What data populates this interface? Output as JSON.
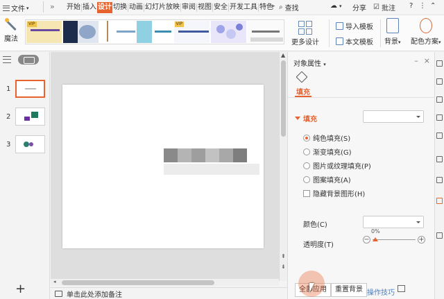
{
  "menubar": {
    "file": "文件",
    "more_arrow": "»",
    "tabs": [
      "开始",
      "插入",
      "设计",
      "切换",
      "动画",
      "幻灯片放映",
      "审阅",
      "视图",
      "安全",
      "开发工具",
      "特色"
    ],
    "active_tab": "设计",
    "search": "查找",
    "share": "分享",
    "comment": "批注",
    "help": "?"
  },
  "ribbon": {
    "magic": "魔法",
    "vip_badge": "VIP",
    "more_designs": "更多设计",
    "import_template": "导入模板",
    "text_template": "本文模板",
    "background": "背景",
    "color_scheme": "配色方案"
  },
  "left_panel": {
    "slides": [
      "1",
      "2",
      "3"
    ],
    "add": "+"
  },
  "status": {
    "notes_placeholder": "单击此处添加备注"
  },
  "right_panel": {
    "title": "对象属性",
    "tab_fill": "填充",
    "section_fill": "填充",
    "options": [
      {
        "label": "纯色填充(S)",
        "checked": true
      },
      {
        "label": "渐变填充(G)",
        "checked": false
      },
      {
        "label": "图片或纹理填充(P)",
        "checked": false
      },
      {
        "label": "图案填充(A)",
        "checked": false
      }
    ],
    "hide_bg": "隐藏背景图形(H)",
    "color_label": "颜色(C)",
    "transparency_label": "透明度(T)",
    "transparency_value": "0%",
    "apply_all": "全部应用",
    "reset_bg": "重置背景",
    "tips": "操作技巧"
  },
  "colors": {
    "accent": "#e8622d",
    "vip": "#f1c24b",
    "link": "#4a7fc1"
  }
}
